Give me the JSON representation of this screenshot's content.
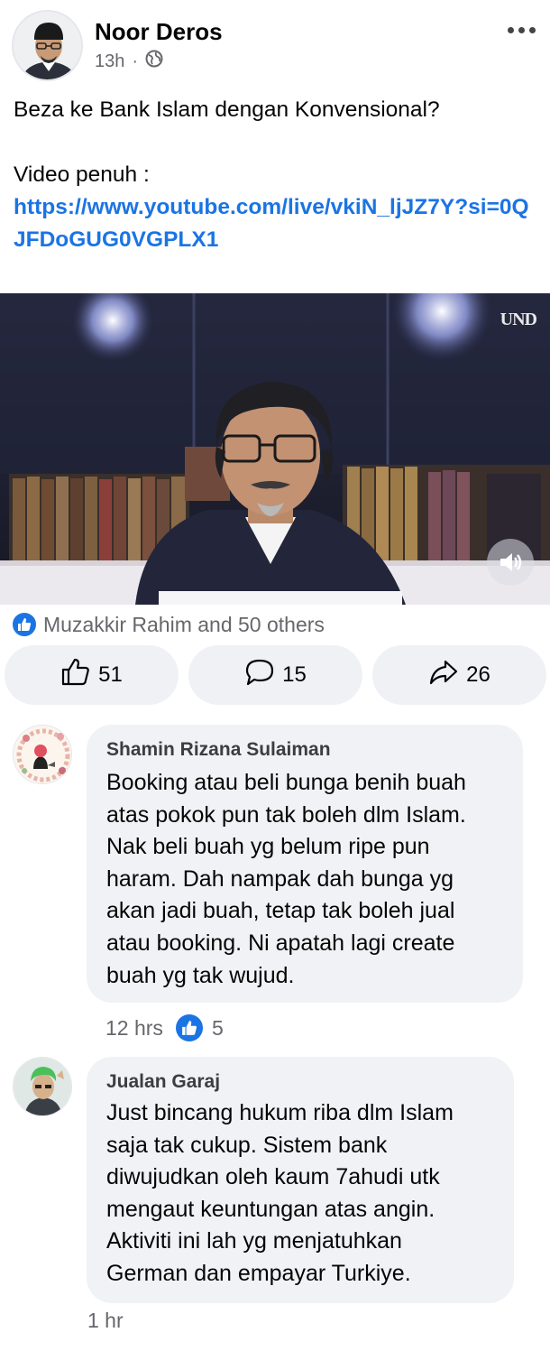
{
  "post": {
    "author": "Noor Deros",
    "time": "13h",
    "dot": "·",
    "audience_icon": "globe-icon",
    "more_icon": "more-options-icon",
    "text_line1": "Beza ke Bank Islam dengan Konvensional?",
    "text_line2": "Video penuh :",
    "link": "https://www.youtube.com/live/vkiN_ljJZ7Y?si=0QJFDoGUG0VGPLX1"
  },
  "video": {
    "watermark": "UND",
    "sound_icon": "speaker-icon"
  },
  "reactions": {
    "summary": "Muzakkir Rahim and 50 others",
    "icon": "like-icon"
  },
  "actions": {
    "like_count": "51",
    "comment_count": "15",
    "share_count": "26"
  },
  "comments": [
    {
      "name": "Shamin Rizana Sulaiman",
      "lines": [
        "Booking atau beli bunga benih buah",
        "atas pokok pun tak boleh dlm Islam.",
        "Nak beli buah yg belum ripe pun",
        "haram. Dah nampak dah bunga yg",
        "akan jadi buah, tetap tak boleh jual",
        "atau booking. Ni apatah lagi create",
        "buah yg tak wujud."
      ],
      "time": "12 hrs",
      "likes": "5"
    },
    {
      "name": "Jualan Garaj",
      "lines": [
        "Just bincang hukum riba dlm Islam",
        "saja tak cukup. Sistem bank",
        "diwujudkan oleh kaum 7ahudi utk",
        "mengaut keuntungan atas angin.",
        "Aktiviti ini lah yg menjatuhkan",
        "German dan empayar Turkiye."
      ],
      "time": "1 hr"
    }
  ],
  "colors": {
    "link": "#1b74e4",
    "secondary_text": "#65676b",
    "bubble": "#f0f2f5",
    "button_bg": "#eff1f4"
  }
}
